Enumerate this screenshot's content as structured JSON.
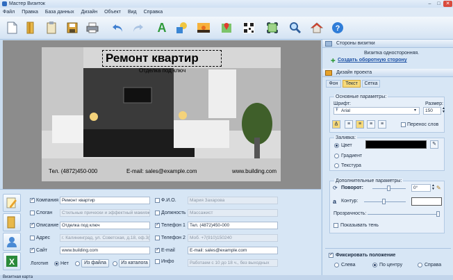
{
  "window": {
    "title": "Мастер Визиток"
  },
  "menu": [
    "Файл",
    "Правка",
    "База данных",
    "Дизайн",
    "Объект",
    "Вид",
    "Справка"
  ],
  "toolbar": {
    "icons": [
      "new-file-icon",
      "open-folder-icon",
      "clipboard-icon",
      "save-icon",
      "print-icon",
      "undo-icon",
      "redo-icon",
      "text-icon",
      "shapes-icon",
      "image-icon",
      "map-icon",
      "qr-code-icon",
      "fit-icon",
      "zoom-icon",
      "home-icon",
      "help-icon"
    ]
  },
  "card": {
    "title": "Ремонт квартир",
    "subtitle": "Отделка под ключ",
    "phone": "Тел. (4872)450-000",
    "email": "E-mail: sales@example.com",
    "site": "www.building.com"
  },
  "fields_left": [
    {
      "label": "Компания",
      "value": "Ремонт квартир",
      "checked": true,
      "enabled": true
    },
    {
      "label": "Слоган",
      "value": "Стильные прически и эффектный макияж",
      "checked": false,
      "enabled": false
    },
    {
      "label": "Описание",
      "value": "Отделка под ключ",
      "checked": true,
      "enabled": true
    },
    {
      "label": "Адрес",
      "value": "г. Калининград, ул. Советская, д.18, оф.3(",
      "checked": false,
      "enabled": false
    },
    {
      "label": "Сайт",
      "value": "www.building.com",
      "checked": true,
      "enabled": true
    }
  ],
  "fields_right": [
    {
      "label": "Ф.И.О.",
      "value": "Мария Захарова",
      "checked": false,
      "enabled": false
    },
    {
      "label": "Должность",
      "value": "Массажист",
      "checked": false,
      "enabled": false
    },
    {
      "label": "Телефон 1",
      "value": "Тел. (4872)450-000",
      "checked": true,
      "enabled": true
    },
    {
      "label": "Телефон 2",
      "value": "Моб. +7(910)150240",
      "checked": false,
      "enabled": false
    },
    {
      "label": "E-mail",
      "value": "E-mail: sales@example.com",
      "checked": true,
      "enabled": true
    },
    {
      "label": "Инфо",
      "value": "Работаем с 10 до 18 ч., без выходных",
      "checked": false,
      "enabled": false
    }
  ],
  "logo": {
    "label": "Логотип",
    "no": "Нет",
    "from_file": "Из файла",
    "from_catalog": "Из каталога"
  },
  "sides": {
    "header": "Стороны визитки",
    "info": "Визитка односторонняя.",
    "create_link": "Создать оборотную сторону"
  },
  "design": {
    "header": "Дизайн проекта",
    "tabs": [
      "Фон",
      "Текст",
      "Сетка"
    ],
    "active_tab": "Текст"
  },
  "text_params": {
    "group": "Основные параметры:",
    "font_label": "Шрифт:",
    "font_value": "Arial",
    "size_label": "Размер:",
    "size_value": "150",
    "wrap_label": "Перенос слов"
  },
  "fill": {
    "group": "Заливка:",
    "color": "Цвет",
    "gradient": "Градиент",
    "texture": "Текстура",
    "swatch": "#000000"
  },
  "extra": {
    "group": "Дополнительные параметры:",
    "rotate": "Поворот:",
    "rotate_value": "0°",
    "outline": "Контур:",
    "transparency": "Прозрачность:",
    "shadow": "Показывать тень"
  },
  "fix": {
    "label": "Фиксировать положение",
    "left": "Слева",
    "center": "По центру",
    "right": "Справа"
  },
  "status": "Визитная карта"
}
